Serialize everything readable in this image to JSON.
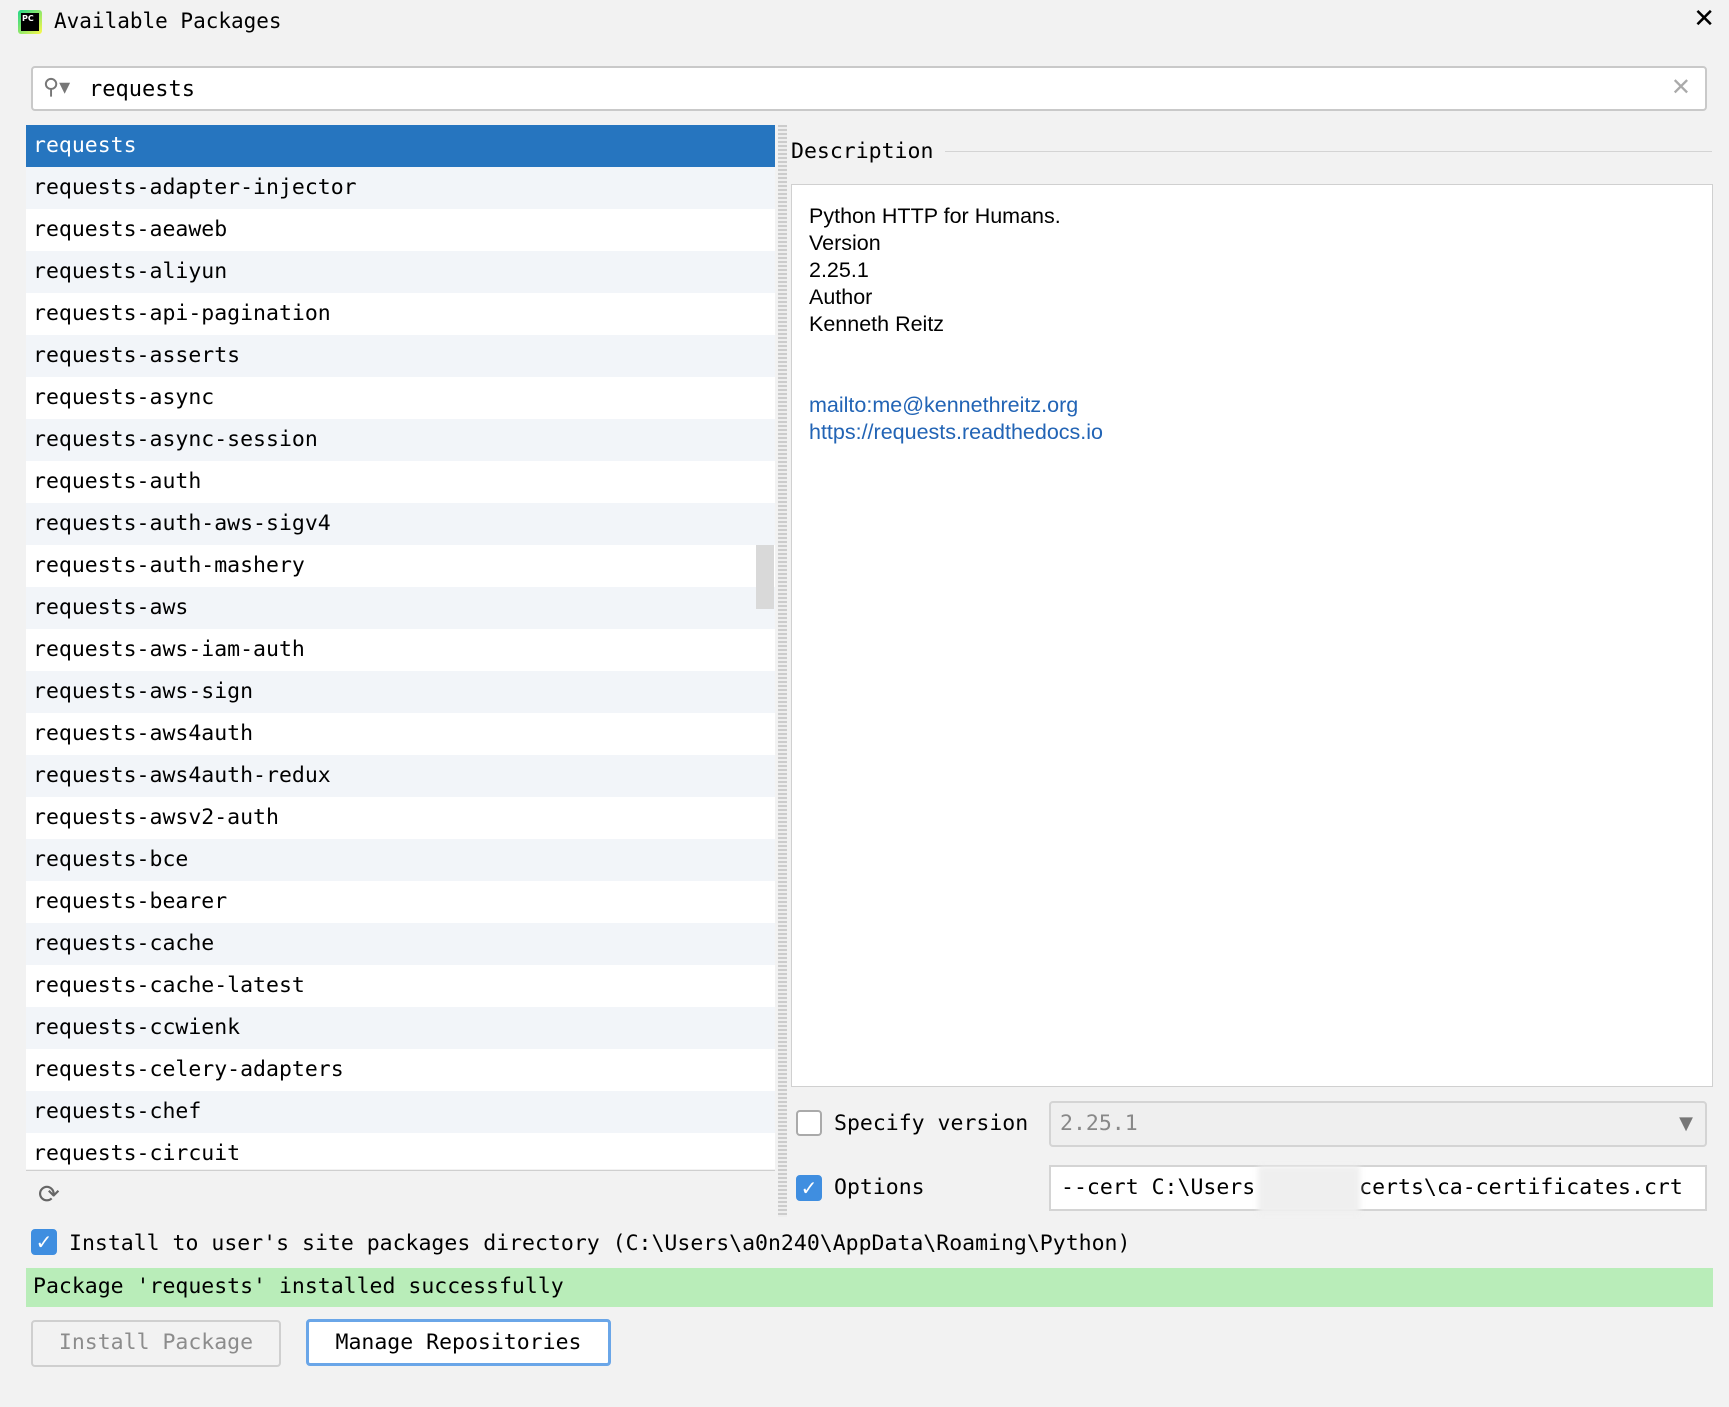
{
  "window": {
    "title": "Available Packages",
    "icon": "pycharm-logo",
    "logo_text": "PC"
  },
  "search": {
    "value": "requests"
  },
  "packages": [
    "requests",
    "requests-adapter-injector",
    "requests-aeaweb",
    "requests-aliyun",
    "requests-api-pagination",
    "requests-asserts",
    "requests-async",
    "requests-async-session",
    "requests-auth",
    "requests-auth-aws-sigv4",
    "requests-auth-mashery",
    "requests-aws",
    "requests-aws-iam-auth",
    "requests-aws-sign",
    "requests-aws4auth",
    "requests-aws4auth-redux",
    "requests-awsv2-auth",
    "requests-bce",
    "requests-bearer",
    "requests-cache",
    "requests-cache-latest",
    "requests-ccwienk",
    "requests-celery-adapters",
    "requests-chef",
    "requests-circuit"
  ],
  "selected_package": "requests",
  "description": {
    "label": "Description",
    "summary": "Python HTTP for Humans.",
    "version_label": "Version",
    "version": "2.25.1",
    "author_label": "Author",
    "author": "Kenneth Reitz",
    "email_link": "mailto:me@kennethreitz.org",
    "url_link": "https://requests.readthedocs.io"
  },
  "specify_version": {
    "label": "Specify version",
    "checked": false,
    "value": "2.25.1"
  },
  "options": {
    "label": "Options",
    "checked": true,
    "value_prefix": "--cert C:\\Users",
    "value_suffix": "certs\\ca-certificates.crt"
  },
  "install_user": {
    "label": "Install to user's site packages directory (C:\\Users\\a0n240\\AppData\\Roaming\\Python)",
    "checked": true
  },
  "status": {
    "text": "Package 'requests' installed successfully",
    "color": "#b9edb9"
  },
  "buttons": {
    "install": "Install Package",
    "manage": "Manage Repositories"
  },
  "check_mark": "✓"
}
